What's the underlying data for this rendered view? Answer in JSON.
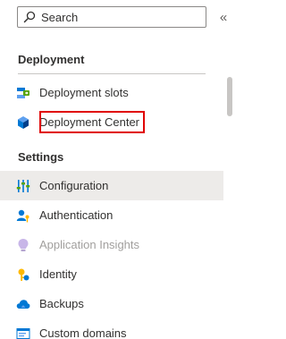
{
  "search": {
    "placeholder": "Search"
  },
  "collapse": {
    "glyph": "«"
  },
  "sections": {
    "deployment": {
      "title": "Deployment",
      "items": [
        {
          "label": "Deployment slots",
          "icon": "deployment-slots-icon"
        },
        {
          "label": "Deployment Center",
          "icon": "deployment-center-icon",
          "highlighted": true
        }
      ]
    },
    "settings": {
      "title": "Settings",
      "items": [
        {
          "label": "Configuration",
          "icon": "configuration-icon",
          "selected": true
        },
        {
          "label": "Authentication",
          "icon": "authentication-icon"
        },
        {
          "label": "Application Insights",
          "icon": "application-insights-icon",
          "disabled": true
        },
        {
          "label": "Identity",
          "icon": "identity-icon"
        },
        {
          "label": "Backups",
          "icon": "backups-icon"
        },
        {
          "label": "Custom domains",
          "icon": "custom-domains-icon"
        }
      ]
    }
  },
  "colors": {
    "highlight": "#e00000",
    "selected_bg": "#edebe9",
    "accent": "#0078d4"
  }
}
